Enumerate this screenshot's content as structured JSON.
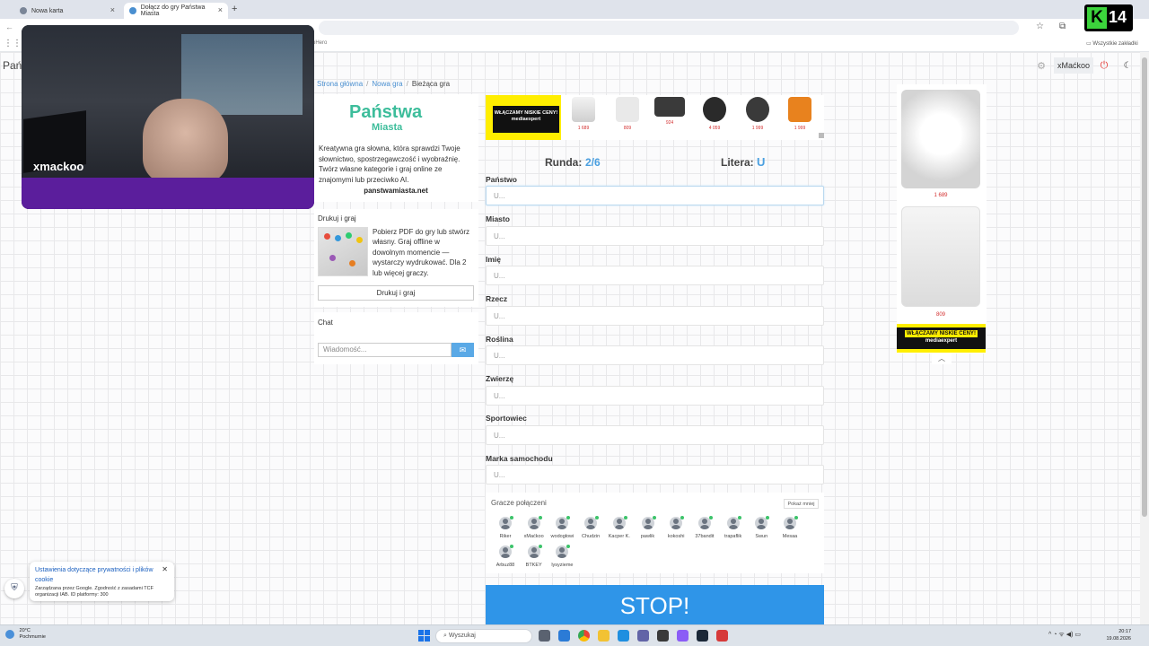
{
  "browser": {
    "tabs": [
      {
        "label": "Nowa karta",
        "active": false
      },
      {
        "label": "Dołącz do gry Państwa Miasta",
        "active": true
      }
    ],
    "url_partial": "oHero",
    "bookmarks_all": "Wszystkie zakładki"
  },
  "site": {
    "title_partial": "Pań",
    "username": "xMaćkoo"
  },
  "breadcrumb": [
    "Strona główna",
    "Nowa gra",
    "Bieżąca gra"
  ],
  "intro": {
    "logo_line1": "Państwa",
    "logo_line2": "Miasta",
    "text": "Kreatywna gra słowna, która sprawdzi Twoje słownictwo, spostrzegawczość i wyobraźnię. Twórz własne kategorie i graj online ze znajomymi lub przeciwko AI.",
    "url": "panstwamiasta.net"
  },
  "print": {
    "heading": "Drukuj i graj",
    "text": "Pobierz PDF do gry lub stwórz własny. Graj offline w dowolnym momencie — wystarczy wydrukować. Dla 2 lub więcej graczy.",
    "button": "Drukuj i graj"
  },
  "chat": {
    "heading": "Chat",
    "placeholder": "Wiadomość..."
  },
  "ad_top": {
    "banner": "WŁĄCZAMY NISKIE CENY!",
    "brand": "mediaexpert",
    "prices": [
      "1 689",
      "809",
      "924",
      "4 059",
      "1 999",
      "1 999"
    ]
  },
  "game": {
    "round_label": "Runda:",
    "round_value": "2/6",
    "letter_label": "Litera:",
    "letter_value": "U",
    "categories": [
      {
        "label": "Państwo",
        "placeholder": "U..."
      },
      {
        "label": "Miasto",
        "placeholder": "U..."
      },
      {
        "label": "Imię",
        "placeholder": "U..."
      },
      {
        "label": "Rzecz",
        "placeholder": "U..."
      },
      {
        "label": "Roślina",
        "placeholder": "U..."
      },
      {
        "label": "Zwierzę",
        "placeholder": "U..."
      },
      {
        "label": "Sportowiec",
        "placeholder": "U..."
      },
      {
        "label": "Marka samochodu",
        "placeholder": "U..."
      }
    ],
    "stop_label": "STOP!"
  },
  "players": {
    "heading": "Gracze połączeni",
    "show_less": "Pokaż mniej",
    "list": [
      "Riker",
      "xMaćkoo",
      "wodogłowi",
      "Chudzin",
      "Kacper K.",
      "pawlik",
      "kokoshi",
      "37bandit",
      "trapaflik",
      "Swun",
      "Mesaa",
      "Arbuz88",
      "BTKEY",
      "lysyzieme"
    ]
  },
  "ad_right": {
    "prices": [
      "1 689",
      "809"
    ],
    "banner": "WŁĄCZAMY NISKIE CENY!",
    "brand": "mediaexpert"
  },
  "stream": {
    "streamer": "xmackoo",
    "badge_letter": "K",
    "badge_number": "14"
  },
  "privacy": {
    "title": "Ustawienia dotyczące prywatności i plików cookie",
    "text": "Zarządzana przez Google. Zgodność z zasadami TCF organizacji IAB. ID platformy: 300"
  },
  "taskbar": {
    "temp": "20°C",
    "weather": "Pochmurnie",
    "search": "Wyszukaj",
    "time": "20:17",
    "date": "19.08.2026"
  }
}
